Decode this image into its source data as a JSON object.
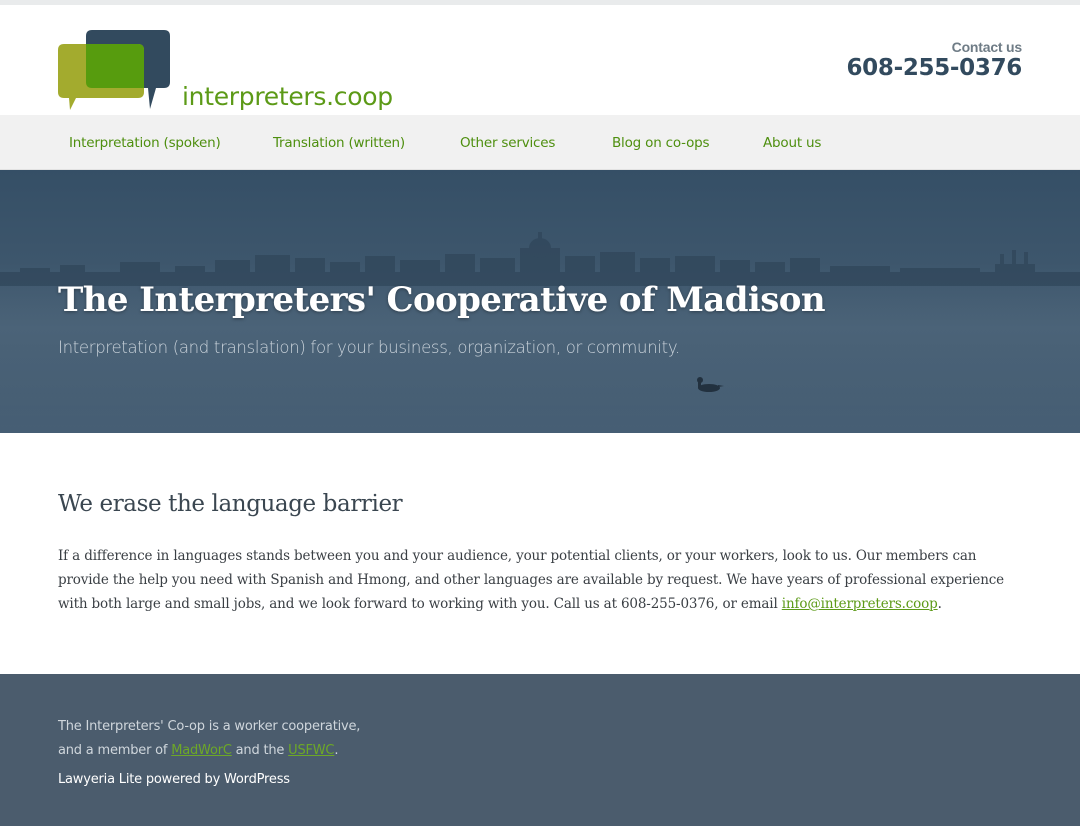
{
  "header": {
    "logo_text": "interpreters.coop",
    "contact_label": "Contact us",
    "phone": "608-255-0376",
    "colors": {
      "logo_green": "#5c9a17",
      "logo_olive": "#a3ab2e",
      "logo_navy": "#324a5e"
    }
  },
  "nav": {
    "items": [
      {
        "label": "Interpretation (spoken)"
      },
      {
        "label": "Translation (written)"
      },
      {
        "label": "Other services"
      },
      {
        "label": "Blog on co-ops"
      },
      {
        "label": "About us"
      }
    ]
  },
  "hero": {
    "title": "The Interpreters' Cooperative of Madison",
    "subtitle": "Interpretation (and translation) for your business, organization, or community."
  },
  "main": {
    "heading": "We erase the language barrier",
    "body_text": "If a difference in languages stands between you and your audience, your potential clients, or your workers, look to us. Our members can provide the help you need with Spanish and Hmong, and other languages are available by request. We have years of professional experience with both large and small jobs, and we look forward to working with you. Call us at 608-255-0376, or email ",
    "email_link": "info@interpreters.coop",
    "body_end": "."
  },
  "footer": {
    "line1": "The Interpreters' Co-op is a worker cooperative,",
    "line2_prefix": "and a member of ",
    "madworc_link": "MadWorC",
    "line2_middle": " and the ",
    "usfwc_link": "USFWC",
    "line2_end": ".",
    "credit": "Lawyeria Lite powered by WordPress"
  },
  "colors": {
    "accent": "#5c9a17",
    "footer_bg": "#4b5c6d",
    "hero_bg": "#3d566c",
    "nav_bg": "#f1f1f1"
  }
}
